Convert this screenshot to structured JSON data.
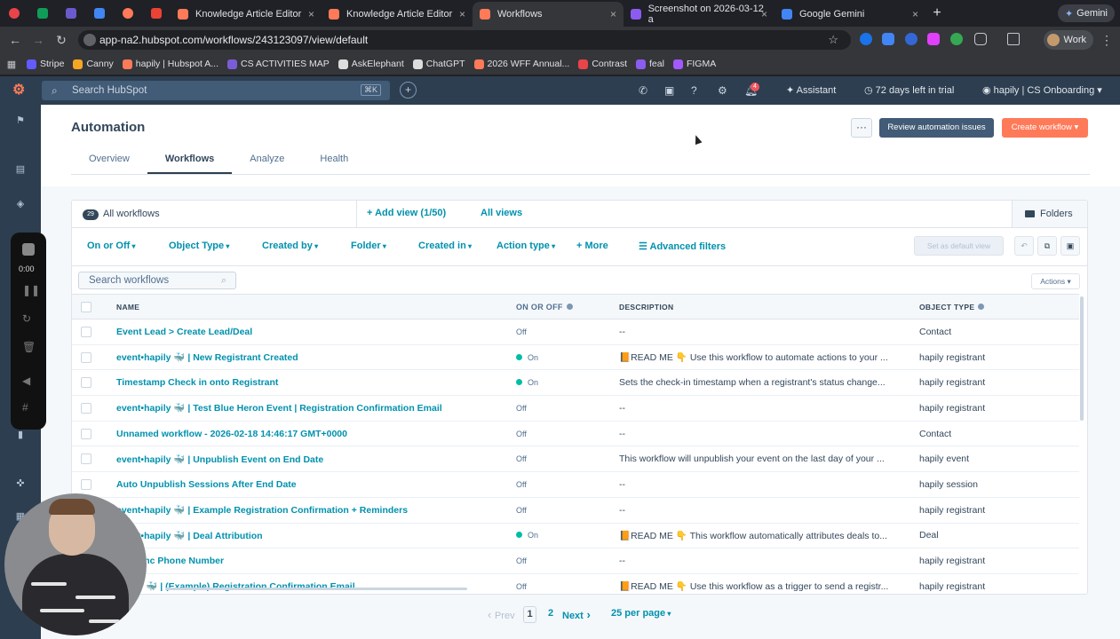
{
  "browser": {
    "tabs": [
      {
        "label": "Knowledge Article Editor",
        "color": "#ff7a59"
      },
      {
        "label": "Knowledge Article Editor",
        "color": "#ff7a59"
      },
      {
        "label": "Workflows",
        "color": "#ff7a59"
      },
      {
        "label": "Screenshot on 2026-03-12 a",
        "color": "#8c5cf0"
      },
      {
        "label": "Google Gemini",
        "color": "#4285f4"
      }
    ],
    "new_tab": "+",
    "gemini_label": "Gemini",
    "url": "app-na2.hubspot.com/workflows/243123097/view/default",
    "profile_label": "Work",
    "bookmarks": [
      {
        "label": "Stripe",
        "color": "#635bff"
      },
      {
        "label": "Canny",
        "color": "#f5a623"
      },
      {
        "label": "hapily | Hubspot A...",
        "color": "#ff7a59"
      },
      {
        "label": "CS ACTIVITIES MAP",
        "color": "#7b5cd6"
      },
      {
        "label": "AskElephant",
        "color": "#dddddd"
      },
      {
        "label": "ChatGPT",
        "color": "#dddddd"
      },
      {
        "label": "2026 WFF Annual...",
        "color": "#ff7a59"
      },
      {
        "label": "Contrast",
        "color": "#e8444a"
      },
      {
        "label": "feal",
        "color": "#8c5cf0"
      },
      {
        "label": "FIGMA",
        "color": "#a259ff"
      }
    ]
  },
  "hubspot": {
    "search_placeholder": "Search HubSpot",
    "search_shortcut": "⌘K",
    "notification_count": "4",
    "assistant_label": "Assistant",
    "trial_label": "72 days left in trial",
    "account_label": "hapily | CS Onboarding",
    "colors": {
      "accent": "#ff7a59",
      "link": "#0091ae",
      "nav": "#2d3e50",
      "on_status": "#00bda5"
    }
  },
  "recorder": {
    "time": "0:00"
  },
  "page": {
    "title": "Automation",
    "more_label": "···",
    "review_label": "Review automation issues",
    "create_label": "Create workflow ▾",
    "subtabs": [
      "Overview",
      "Workflows",
      "Analyze",
      "Health"
    ],
    "active_subtab": "Workflows"
  },
  "views": {
    "count": "29",
    "all_label": "All workflows",
    "add_view": "+ Add view (1/50)",
    "all_views": "All views",
    "folders": "Folders"
  },
  "filters": {
    "items": [
      "On or Off",
      "Object Type",
      "Created by",
      "Folder",
      "Created in",
      "Action type"
    ],
    "more": "+ More",
    "advanced": "Advanced filters",
    "set_default": "Set as default view"
  },
  "table": {
    "search_placeholder": "Search workflows",
    "actions_label": "Actions ▾",
    "columns": [
      "NAME",
      "ON OR OFF",
      "DESCRIPTION",
      "OBJECT TYPE"
    ],
    "rows": [
      {
        "name": "Event Lead > Create Lead/Deal",
        "status": "Off",
        "description": "--",
        "object_type": "Contact"
      },
      {
        "name": "event•hapily 🐳 | New Registrant Created",
        "status": "On",
        "description": "📙READ ME 👇 Use this workflow to automate actions to your ...",
        "object_type": "hapily registrant"
      },
      {
        "name": "Timestamp Check in onto Registrant",
        "status": "On",
        "description": "Sets the check-in timestamp when a registrant's status change...",
        "object_type": "hapily registrant"
      },
      {
        "name": "event•hapily 🐳 | Test Blue Heron Event | Registration Confirmation Email",
        "status": "Off",
        "description": "--",
        "object_type": "hapily registrant"
      },
      {
        "name": "Unnamed workflow - 2026-02-18 14:46:17 GMT+0000",
        "status": "Off",
        "description": "--",
        "object_type": "Contact"
      },
      {
        "name": "event•hapily 🐳 | Unpublish Event on End Date",
        "status": "Off",
        "description": "This workflow will unpublish your event on the last day of your ...",
        "object_type": "hapily event"
      },
      {
        "name": "Auto Unpublish Sessions After End Date",
        "status": "Off",
        "description": "--",
        "object_type": "hapily session"
      },
      {
        "name": "event•hapily 🐳 | Example Registration Confirmation + Reminders",
        "status": "Off",
        "description": "--",
        "object_type": "hapily registrant"
      },
      {
        "name": "event•hapily 🐳 | Deal Attribution",
        "status": "On",
        "description": "📙READ ME 👇 This workflow automatically attributes deals to...",
        "object_type": "Deal"
      },
      {
        "name": "p > Sync Phone Number",
        "status": "Off",
        "description": "--",
        "object_type": "hapily registrant"
      },
      {
        "name": "hapily 🐳 | (Example) Registration Confirmation Email",
        "status": "Off",
        "description": "📙READ ME 👇 Use this workflow as a trigger to send a registr...",
        "object_type": "hapily registrant"
      }
    ]
  },
  "pagination": {
    "prev": "Prev",
    "page1": "1",
    "page2": "2",
    "next": "Next",
    "per_page": "25 per page"
  }
}
